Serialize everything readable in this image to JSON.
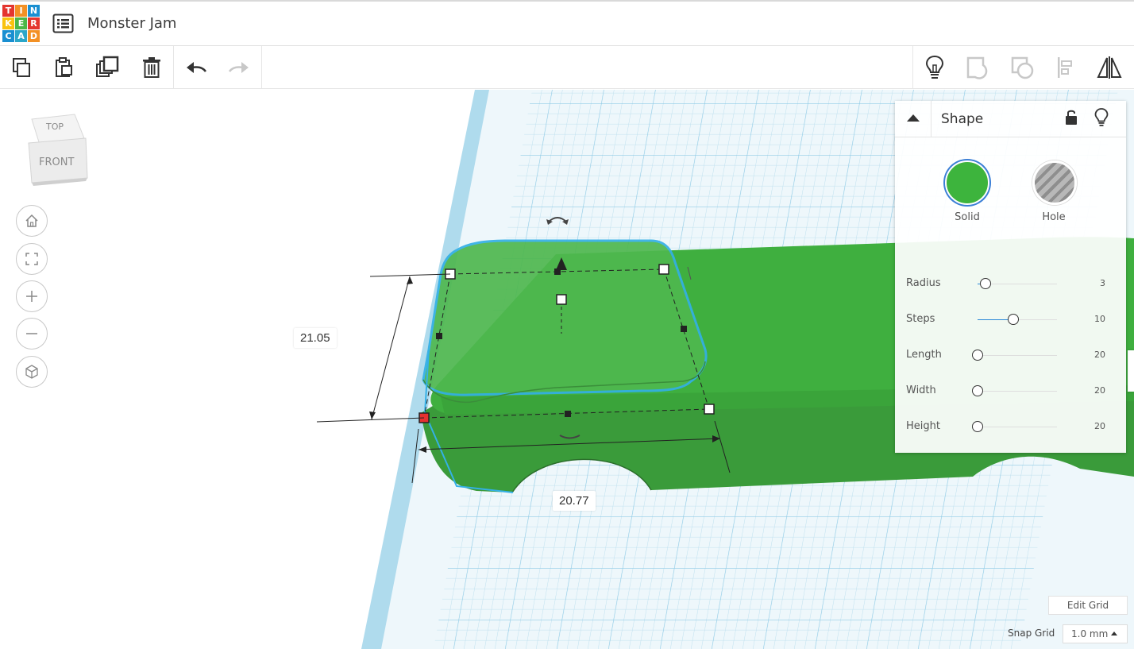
{
  "app": {
    "logo_letters": [
      "T",
      "I",
      "N",
      "K",
      "E",
      "R",
      "C",
      "A",
      "D"
    ],
    "title": "Monster Jam"
  },
  "toolbar": {
    "left_icons": [
      "copy-icon",
      "paste-icon",
      "duplicate-icon",
      "delete-icon",
      "undo-icon",
      "redo-icon"
    ],
    "right_icons": [
      "lightbulb-icon",
      "group-icon",
      "ungroup-icon",
      "align-icon",
      "mirror-icon"
    ]
  },
  "viewcube": {
    "top_label": "TOP",
    "front_label": "FRONT"
  },
  "nav": [
    "home-icon",
    "fit-icon",
    "zoom-in-icon",
    "zoom-out-icon",
    "perspective-icon"
  ],
  "dimensions": {
    "height": "21.05",
    "length": "20.77"
  },
  "panel": {
    "title": "Shape",
    "solid_label": "Solid",
    "hole_label": "Hole",
    "solid_color": "#3db43d",
    "params": [
      {
        "label": "Radius",
        "value": "3",
        "fraction": 0.1
      },
      {
        "label": "Steps",
        "value": "10",
        "fraction": 0.45
      },
      {
        "label": "Length",
        "value": "20",
        "fraction": 0.0
      },
      {
        "label": "Width",
        "value": "20",
        "fraction": 0.0
      },
      {
        "label": "Height",
        "value": "20",
        "fraction": 0.0
      }
    ]
  },
  "grid": {
    "edit_grid_label": "Edit Grid",
    "snap_grid_label": "Snap Grid",
    "snap_value": "1.0 mm"
  },
  "colors": {
    "shape_green": "#3db43d",
    "grid_blue": "#8fcbe6",
    "selection": "#34b0e6"
  }
}
